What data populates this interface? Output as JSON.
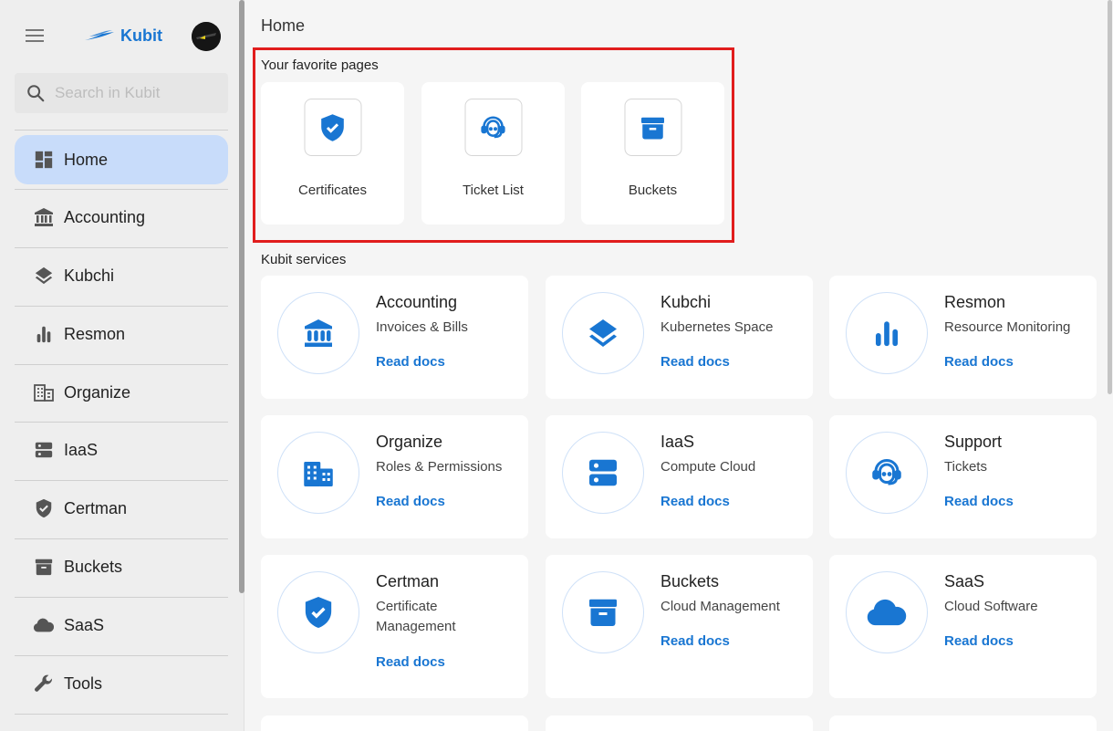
{
  "app": {
    "logo_text": "Kubit"
  },
  "search": {
    "placeholder": "Search in Kubit",
    "value": ""
  },
  "sidebar": {
    "items": [
      {
        "label": "Home",
        "icon": "dashboard-icon",
        "active": true
      },
      {
        "label": "Accounting",
        "icon": "bank-icon"
      },
      {
        "label": "Kubchi",
        "icon": "layers-icon"
      },
      {
        "label": "Resmon",
        "icon": "bar-chart-icon"
      },
      {
        "label": "Organize",
        "icon": "building-icon"
      },
      {
        "label": "IaaS",
        "icon": "server-icon"
      },
      {
        "label": "Certman",
        "icon": "shield-check-icon"
      },
      {
        "label": "Buckets",
        "icon": "archive-box-icon"
      },
      {
        "label": "SaaS",
        "icon": "cloud-icon"
      },
      {
        "label": "Tools",
        "icon": "wrench-icon"
      }
    ]
  },
  "main": {
    "title": "Home",
    "favorites_title": "Your favorite pages",
    "favorites": [
      {
        "label": "Certificates",
        "icon": "shield-check-icon"
      },
      {
        "label": "Ticket List",
        "icon": "support-agent-icon"
      },
      {
        "label": "Buckets",
        "icon": "archive-box-icon"
      }
    ],
    "services_title": "Kubit services",
    "services": [
      {
        "name": "Accounting",
        "desc": "Invoices & Bills",
        "link": "Read docs",
        "icon": "bank-icon"
      },
      {
        "name": "Kubchi",
        "desc": "Kubernetes Space",
        "link": "Read docs",
        "icon": "layers-icon"
      },
      {
        "name": "Resmon",
        "desc": "Resource Monitoring",
        "link": "Read docs",
        "icon": "bar-chart-icon"
      },
      {
        "name": "Organize",
        "desc": "Roles & Permissions",
        "link": "Read docs",
        "icon": "building-icon"
      },
      {
        "name": "IaaS",
        "desc": "Compute Cloud",
        "link": "Read docs",
        "icon": "server-icon"
      },
      {
        "name": "Support",
        "desc": "Tickets",
        "link": "Read docs",
        "icon": "support-agent-icon"
      },
      {
        "name": "Certman",
        "desc": "Certificate Management",
        "link": "Read docs",
        "icon": "shield-check-icon"
      },
      {
        "name": "Buckets",
        "desc": "Cloud Management",
        "link": "Read docs",
        "icon": "archive-box-icon"
      },
      {
        "name": "SaaS",
        "desc": "Cloud Software",
        "link": "Read docs",
        "icon": "cloud-icon"
      }
    ]
  },
  "colors": {
    "accent": "#1976d2",
    "active_nav": "#c8dcfa",
    "highlight": "#e11d1d"
  }
}
